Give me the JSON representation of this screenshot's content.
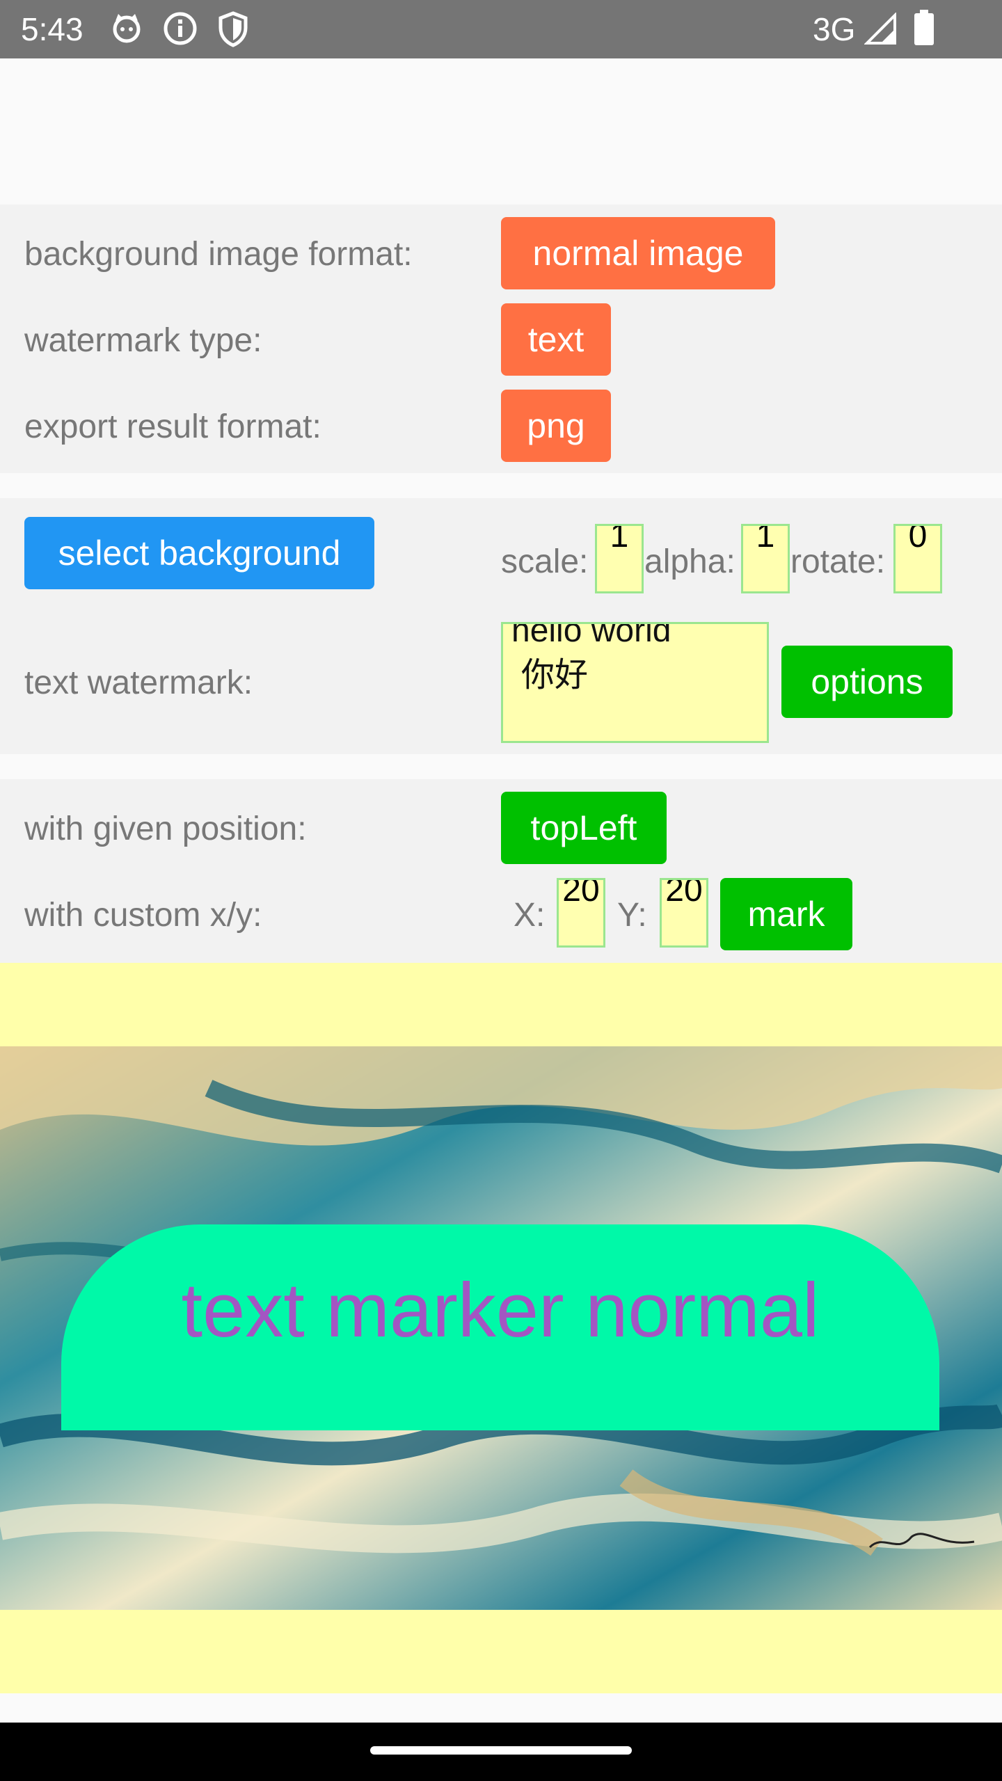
{
  "status_bar": {
    "time": "5:43",
    "network": "3G",
    "icons": [
      "cat-face-icon",
      "info-icon",
      "shield-icon",
      "signal-icon",
      "battery-icon"
    ]
  },
  "format_panel": {
    "background_format_label": "background image format:",
    "background_format_value": "normal image",
    "watermark_type_label": "watermark type:",
    "watermark_type_value": "text",
    "export_format_label": "export result format:",
    "export_format_value": "png"
  },
  "settings_panel": {
    "select_background_label": "select background",
    "scale_label": "scale:",
    "scale_value": "1",
    "alpha_label": "alpha:",
    "alpha_value": "1",
    "rotate_label": "rotate:",
    "rotate_value": "0",
    "text_watermark_label": "text watermark:",
    "text_watermark_line1": "hello world",
    "text_watermark_line2": "你好",
    "options_label": "options"
  },
  "position_panel": {
    "given_position_label": "with given position:",
    "given_position_value": "topLeft",
    "custom_xy_label": "with custom x/y:",
    "x_label": "X:",
    "x_value": "20",
    "y_label": "Y:",
    "y_value": "20",
    "mark_label": "mark"
  },
  "preview": {
    "watermark_text": "text marker normal"
  },
  "colors": {
    "orange": "#ff7043",
    "blue": "#2196f3",
    "green": "#00c000",
    "input_bg": "#ffffb0",
    "watermark_bg": "#00f9a8",
    "watermark_text": "#a356c2"
  }
}
